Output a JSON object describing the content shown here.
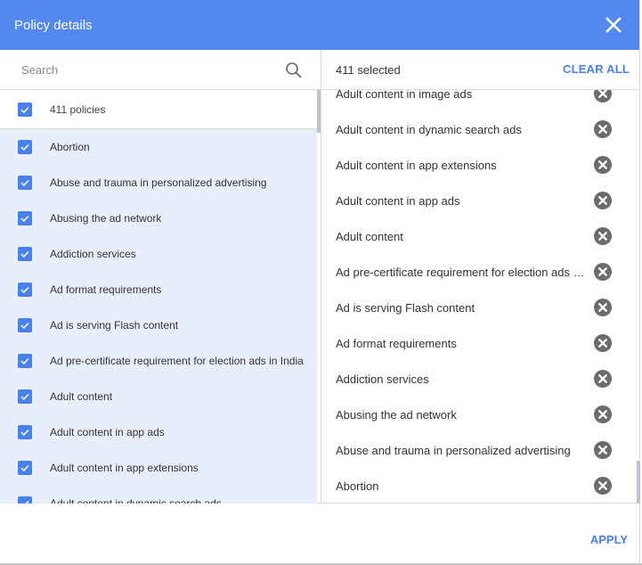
{
  "dialog": {
    "title": "Policy details",
    "close_icon": "close-icon"
  },
  "left_panel": {
    "search_placeholder": "Search",
    "search_value": "",
    "select_all_label": "411 policies",
    "select_all_checked": true,
    "policies": [
      {
        "label": "Abortion",
        "checked": true
      },
      {
        "label": "Abuse and trauma in personalized advertising",
        "checked": true
      },
      {
        "label": "Abusing the ad network",
        "checked": true
      },
      {
        "label": "Addiction services",
        "checked": true
      },
      {
        "label": "Ad format requirements",
        "checked": true
      },
      {
        "label": "Ad is serving Flash content",
        "checked": true
      },
      {
        "label": "Ad pre-certificate requirement for election ads in India",
        "checked": true
      },
      {
        "label": "Adult content",
        "checked": true
      },
      {
        "label": "Adult content in app ads",
        "checked": true
      },
      {
        "label": "Adult content in app extensions",
        "checked": true
      },
      {
        "label": "Adult content in dynamic search ads",
        "checked": true
      }
    ]
  },
  "right_panel": {
    "selected_count": "411 selected",
    "clear_all_label": "CLEAR ALL",
    "selected": [
      "Adult content in image ads",
      "Adult content in dynamic search ads",
      "Adult content in app extensions",
      "Adult content in app ads",
      "Adult content",
      "Ad pre-certificate requirement for election ads in India",
      "Ad is serving Flash content",
      "Ad format requirements",
      "Addiction services",
      "Abusing the ad network",
      "Abuse and trauma in personalized advertising",
      "Abortion"
    ]
  },
  "footer": {
    "apply_label": "APPLY"
  },
  "colors": {
    "header": "#5388f0",
    "accent": "#4a80eb",
    "selected_row_bg": "#e8effb",
    "remove_icon": "#6b6b6b"
  }
}
